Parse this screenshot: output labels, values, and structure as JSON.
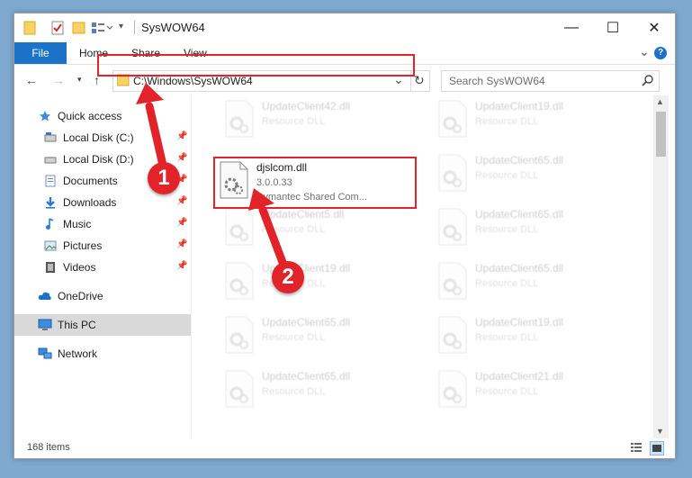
{
  "window": {
    "title": "SysWOW64",
    "minimize_glyph": "—",
    "maximize_glyph": "☐",
    "close_glyph": "✕"
  },
  "ribbon": {
    "tabs": [
      "File",
      "Home",
      "Share",
      "View"
    ],
    "expand_glyph": "⌄",
    "help_glyph": "?"
  },
  "address": {
    "path": "C:\\Windows\\SysWOW64",
    "dropdown_glyph": "⌄",
    "refresh_glyph": "↻"
  },
  "search": {
    "placeholder": "Search SysWOW64"
  },
  "nav": {
    "quick_access": "Quick access",
    "local_c": "Local Disk (C:)",
    "local_d": "Local Disk (D:)",
    "documents": "Documents",
    "downloads": "Downloads",
    "music": "Music",
    "pictures": "Pictures",
    "videos": "Videos",
    "onedrive": "OneDrive",
    "this_pc": "This PC",
    "network": "Network"
  },
  "highlighted_file": {
    "name": "djslcom.dll",
    "version": "3.0.0.33",
    "description": "Symantec Shared Com..."
  },
  "files_left": [
    {
      "name": "UpdateClient42.dll",
      "desc": "Resource DLL"
    },
    {
      "name": "UpdateClient5.dll",
      "desc": "Resource DLL"
    },
    {
      "name": "UpdateClient19.dll",
      "desc": "Resource DLL"
    },
    {
      "name": "UpdateClient65.dll",
      "desc": "Resource DLL"
    },
    {
      "name": "UpdateClient65.dll",
      "desc": "Resource DLL"
    }
  ],
  "files_right": [
    {
      "name": "UpdateClient19.dll",
      "desc": "Resource DLL"
    },
    {
      "name": "UpdateClient65.dll",
      "desc": "Resource DLL"
    },
    {
      "name": "UpdateClient65.dll",
      "desc": "Resource DLL"
    },
    {
      "name": "UpdateClient65.dll",
      "desc": "Resource DLL"
    },
    {
      "name": "UpdateClient19.dll",
      "desc": "Resource DLL"
    },
    {
      "name": "UpdateClient21.dll",
      "desc": "Resource DLL"
    }
  ],
  "status": {
    "items": "168 items"
  },
  "annotations": {
    "step1": "1",
    "step2": "2"
  },
  "colors": {
    "accent": "#1a73c9",
    "highlight": "#e2242a",
    "folder": "#f6d365",
    "selected": "#d9d9d9"
  }
}
